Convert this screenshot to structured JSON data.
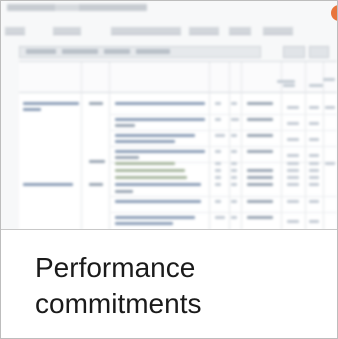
{
  "tile": {
    "caption": "Performance commitments"
  },
  "preview": {
    "accent": "#e8743b"
  },
  "colors": {
    "border": "#bdbdbd",
    "caption_text": "#1a1a1a",
    "badge": "#e8743b"
  }
}
